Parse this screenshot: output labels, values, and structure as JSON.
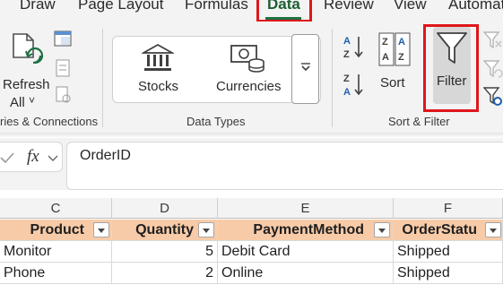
{
  "tabs": [
    {
      "label": "Draw"
    },
    {
      "label": "Page Layout"
    },
    {
      "label": "Formulas"
    },
    {
      "label": "Data"
    },
    {
      "label": "Review"
    },
    {
      "label": "View"
    },
    {
      "label": "Automat"
    }
  ],
  "ribbon": {
    "queries": {
      "refresh_line1": "Refresh",
      "refresh_line2": "All",
      "chevron": "˅",
      "group_label": "ries & Connections"
    },
    "data_types": {
      "stocks": "Stocks",
      "currencies": "Currencies",
      "group_label": "Data Types"
    },
    "sort_filter": {
      "sort": "Sort",
      "filter": "Filter",
      "group_label": "Sort & Filter"
    }
  },
  "formula_bar": {
    "fx": "fx",
    "value": "OrderID"
  },
  "grid": {
    "columns": [
      "C",
      "D",
      "E",
      "F"
    ],
    "header_row": [
      "Product",
      "Quantity",
      "PaymentMethod",
      "OrderStatu"
    ],
    "rows": [
      [
        "Monitor",
        "5",
        "Debit Card",
        "Shipped"
      ],
      [
        "Phone",
        "2",
        "Online",
        "Shipped"
      ]
    ]
  },
  "colors": {
    "highlight_red": "#e0161a",
    "header_fill": "#f8cba8",
    "accent_green": "#1e7145"
  }
}
